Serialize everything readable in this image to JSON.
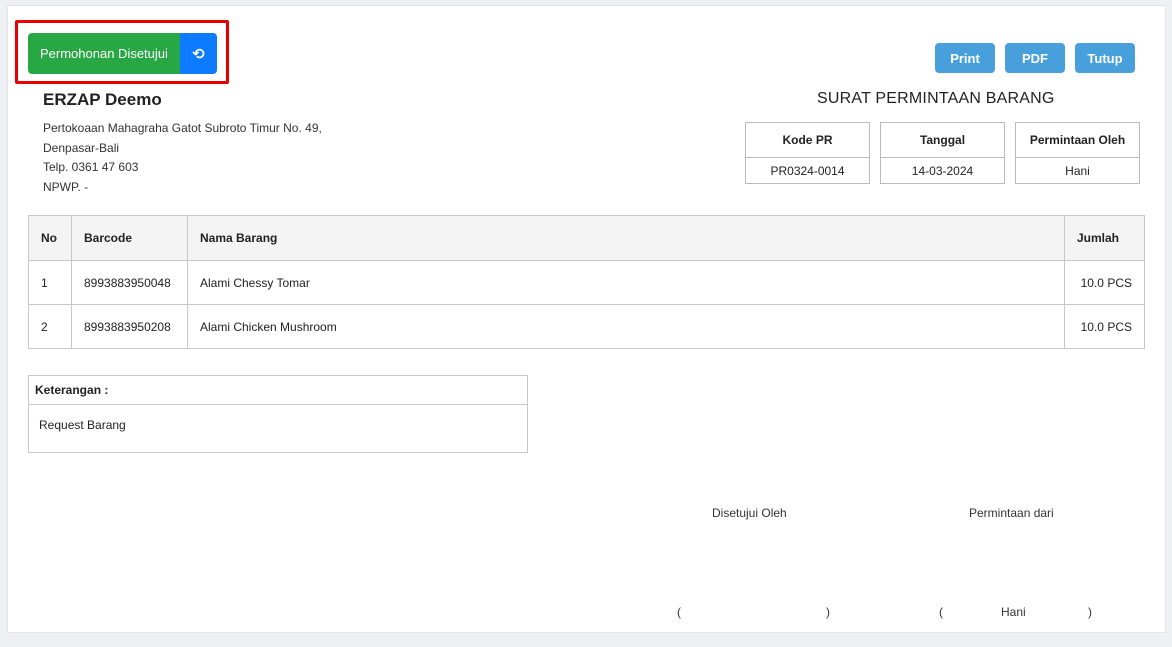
{
  "actions": {
    "approve_label": "Permohonan Disetujui",
    "reset_icon": "undo-icon",
    "print_label": "Print",
    "pdf_label": "PDF",
    "close_label": "Tutup"
  },
  "company": {
    "name": "ERZAP Deemo",
    "address1": "Pertokoaan Mahagraha Gatot Subroto Timur No. 49,",
    "address2": "Denpasar-Bali",
    "phone": "Telp. 0361 47 603",
    "npwp": "NPWP. -"
  },
  "document": {
    "title": "SURAT PERMINTAAN BARANG",
    "info": [
      {
        "label": "Kode PR",
        "value": "PR0324-0014"
      },
      {
        "label": "Tanggal",
        "value": "14-03-2024"
      },
      {
        "label": "Permintaan Oleh",
        "value": "Hani"
      }
    ]
  },
  "items_table": {
    "headers": [
      "No",
      "Barcode",
      "Nama Barang",
      "Jumlah"
    ],
    "rows": [
      {
        "no": "1",
        "barcode": "8993883950048",
        "name": "Alami Chessy Tomar",
        "qty": "10.0 PCS"
      },
      {
        "no": "2",
        "barcode": "8993883950208",
        "name": "Alami Chicken Mushroom",
        "qty": "10.0 PCS"
      }
    ]
  },
  "notes": {
    "label": "Keterangan :",
    "text": "Request Barang"
  },
  "signatures": {
    "approved_by_label": "Disetujui Oleh",
    "requested_from_label": "Permintaan dari",
    "approved_by_name": "",
    "requested_from_name": "Hani",
    "open_paren": "(",
    "close_paren": ")"
  },
  "colors": {
    "approve": "#28a745",
    "reset": "#0d7bff",
    "toolbar": "#47a0db",
    "highlight": "#e60000"
  }
}
